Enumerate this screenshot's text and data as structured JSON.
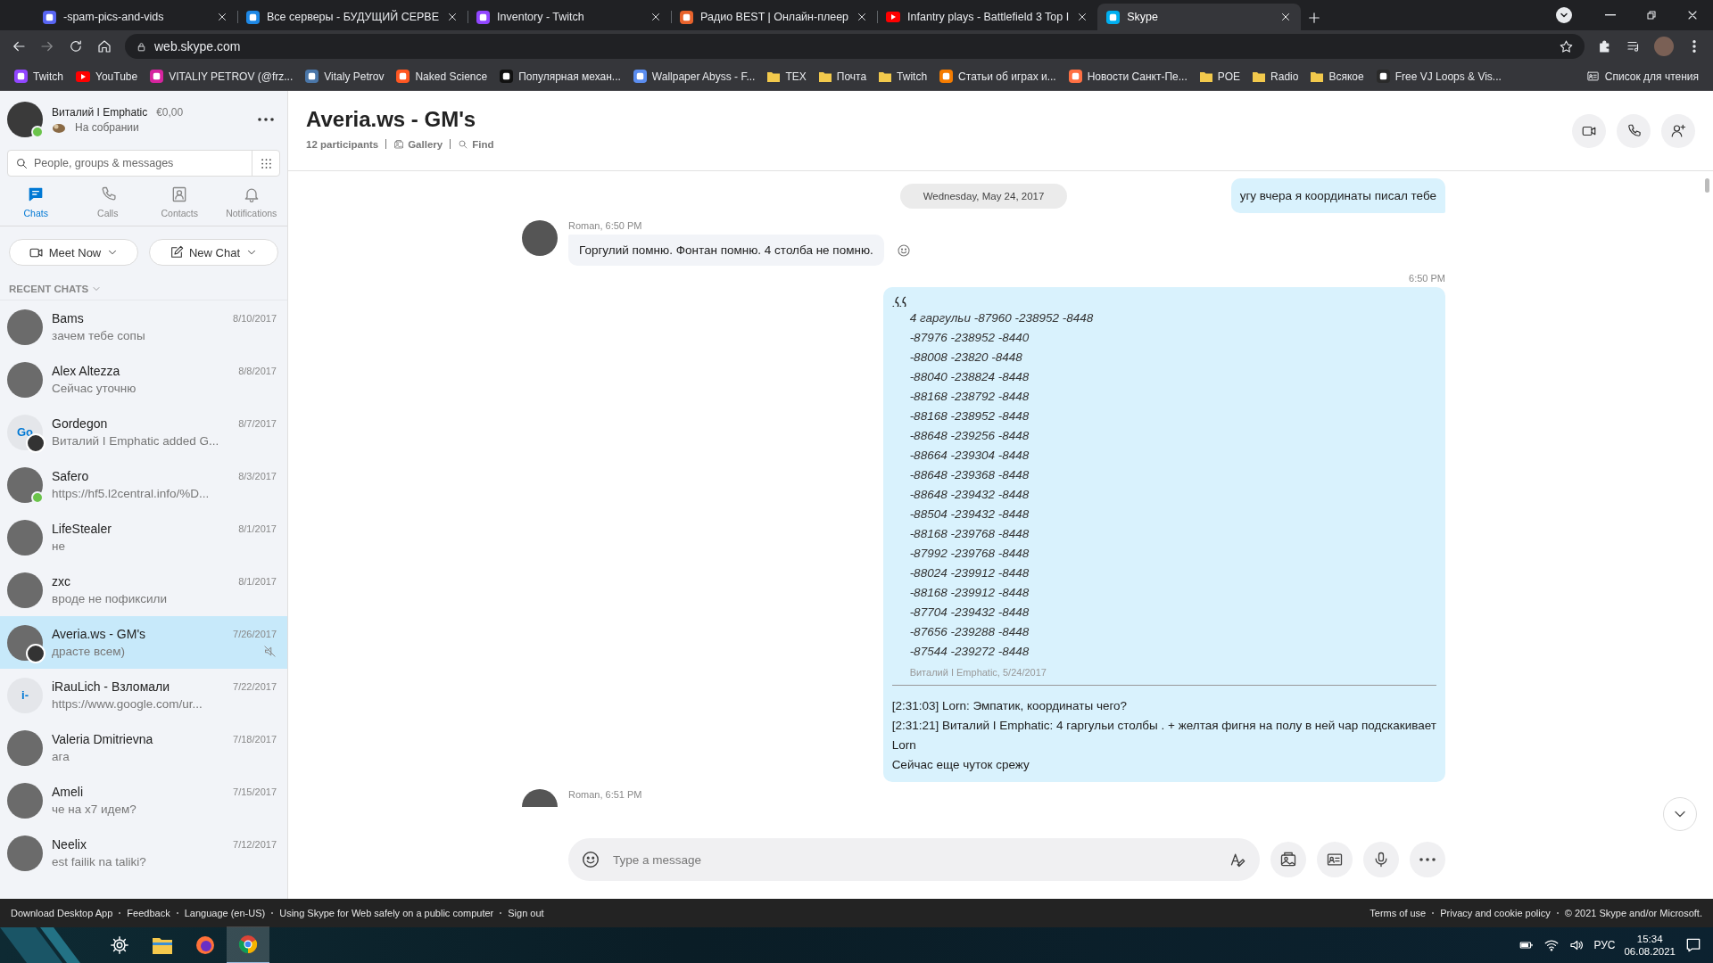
{
  "browser": {
    "tabs": [
      {
        "title": "-spam-pics-and-vids",
        "icon": {
          "kind": "site",
          "color": "#5865f2"
        },
        "selected": false
      },
      {
        "title": "Все серверы - БУДУЩИЙ СЕРВЕ",
        "icon": {
          "kind": "site",
          "color": "#1e88e5"
        },
        "selected": false
      },
      {
        "title": "Inventory - Twitch",
        "icon": {
          "kind": "site",
          "color": "#9146ff"
        },
        "selected": false
      },
      {
        "title": "Радио BEST | Онлайн-плеер",
        "icon": {
          "kind": "site",
          "color": "#e8632c"
        },
        "selected": false
      },
      {
        "title": "Infantry plays - Battlefield 3 Top I",
        "icon": {
          "kind": "play",
          "color": "#ff0000"
        },
        "selected": false
      },
      {
        "title": "Skype",
        "icon": {
          "kind": "site",
          "color": "#00aff0"
        },
        "selected": true
      }
    ],
    "url": "web.skype.com",
    "bookmarks": [
      {
        "label": "Twitch",
        "icon": {
          "kind": "site",
          "color": "#9146ff"
        }
      },
      {
        "label": "YouTube",
        "icon": {
          "kind": "play",
          "color": "#ff0000"
        }
      },
      {
        "label": "VITALIY PETROV (@frz...",
        "icon": {
          "kind": "site",
          "color": "#d6249f"
        }
      },
      {
        "label": "Vitaly Petrov",
        "icon": {
          "kind": "site",
          "color": "#4a76a8"
        }
      },
      {
        "label": "Naked Science",
        "icon": {
          "kind": "site",
          "color": "#ff5722"
        }
      },
      {
        "label": "Популярная механ...",
        "icon": {
          "kind": "site",
          "color": "#111111"
        }
      },
      {
        "label": "Wallpaper Abyss - F...",
        "icon": {
          "kind": "site",
          "color": "#5b8def"
        }
      },
      {
        "label": "TEX",
        "icon": {
          "kind": "folder",
          "color": "#f2c94c"
        }
      },
      {
        "label": "Почта",
        "icon": {
          "kind": "folder",
          "color": "#f2c94c"
        }
      },
      {
        "label": "Twitch",
        "icon": {
          "kind": "folder",
          "color": "#f2c94c"
        }
      },
      {
        "label": "Статьи об играх и...",
        "icon": {
          "kind": "site",
          "color": "#f57c00"
        }
      },
      {
        "label": "Новости Санкт-Пе...",
        "icon": {
          "kind": "site",
          "color": "#ff7043"
        }
      },
      {
        "label": "POE",
        "icon": {
          "kind": "folder",
          "color": "#f2c94c"
        }
      },
      {
        "label": "Radio",
        "icon": {
          "kind": "folder",
          "color": "#f2c94c"
        }
      },
      {
        "label": "Всякое",
        "icon": {
          "kind": "folder",
          "color": "#f2c94c"
        }
      },
      {
        "label": "Free VJ Loops & Vis...",
        "icon": {
          "kind": "site",
          "color": "#2a2a2a"
        }
      }
    ],
    "reading_list": "Список для чтения"
  },
  "sidebar": {
    "profile": {
      "name": "Виталий I Emphatic",
      "balance": "€0,00",
      "status": "На собрании",
      "online": true
    },
    "search": {
      "placeholder": "People, groups & messages"
    },
    "nav": [
      {
        "label": "Chats",
        "kind": "chats",
        "selected": true
      },
      {
        "label": "Calls",
        "kind": "calls",
        "selected": false
      },
      {
        "label": "Contacts",
        "kind": "contacts",
        "selected": false
      },
      {
        "label": "Notifications",
        "kind": "notifications",
        "selected": false
      }
    ],
    "buttons": [
      {
        "label": "Meet Now",
        "kind": "meet"
      },
      {
        "label": "New Chat",
        "kind": "new"
      }
    ],
    "recent_label": "RECENT CHATS",
    "chats": [
      {
        "name": "Bams",
        "date": "8/10/2017",
        "preview": "зачем тебе сопы",
        "avatar": {
          "kind": "photo"
        },
        "online": false,
        "group": false,
        "muted": false,
        "selected": false
      },
      {
        "name": "Alex Altezza",
        "date": "8/8/2017",
        "preview": "Сейчас уточню",
        "avatar": {
          "kind": "photo"
        },
        "online": false,
        "group": false,
        "muted": false,
        "selected": false
      },
      {
        "name": "Gordegon",
        "date": "8/7/2017",
        "preview": "Виталий I Emphatic added G...",
        "avatar": {
          "kind": "initials",
          "initials": "Go"
        },
        "online": false,
        "group": true,
        "muted": false,
        "selected": false
      },
      {
        "name": "Safero",
        "date": "8/3/2017",
        "preview": "https://hf5.l2central.info/%D...",
        "avatar": {
          "kind": "photo"
        },
        "online": true,
        "group": false,
        "muted": false,
        "selected": false
      },
      {
        "name": "LifeStealer",
        "date": "8/1/2017",
        "preview": "не",
        "avatar": {
          "kind": "photo"
        },
        "online": false,
        "group": false,
        "muted": false,
        "selected": false
      },
      {
        "name": "zxc",
        "date": "8/1/2017",
        "preview": "вроде не пофиксили",
        "avatar": {
          "kind": "photo"
        },
        "online": false,
        "group": false,
        "muted": false,
        "selected": false
      },
      {
        "name": "Averia.ws - GM's",
        "date": "7/26/2017",
        "preview": "драсте всем)",
        "avatar": {
          "kind": "photo"
        },
        "online": false,
        "group": true,
        "muted": true,
        "selected": true
      },
      {
        "name": "iRauLich - Взломали",
        "date": "7/22/2017",
        "preview": "https://www.google.com/ur...",
        "avatar": {
          "kind": "initials",
          "initials": "i-"
        },
        "online": false,
        "group": false,
        "muted": false,
        "selected": false
      },
      {
        "name": "Valeria Dmitrievna",
        "date": "7/18/2017",
        "preview": "ага",
        "avatar": {
          "kind": "photo"
        },
        "online": false,
        "group": false,
        "muted": false,
        "selected": false
      },
      {
        "name": "Ameli",
        "date": "7/15/2017",
        "preview": "че на х7 идем?",
        "avatar": {
          "kind": "photo"
        },
        "online": false,
        "group": false,
        "muted": false,
        "selected": false
      },
      {
        "name": "Neelix",
        "date": "7/12/2017",
        "preview": "est failik na taliki?",
        "avatar": {
          "kind": "photo"
        },
        "online": false,
        "group": false,
        "muted": false,
        "selected": false
      }
    ]
  },
  "chat": {
    "title": "Averia.ws - GM's",
    "participants": "12 participants",
    "gallery": "Gallery",
    "find": "Find",
    "top_row": {
      "date": "Wednesday, May 24, 2017",
      "message": "угу вчера я координаты писал тебе"
    },
    "messages": [
      {
        "kind": "incoming",
        "author": "Roman, 6:50 PM",
        "text": "Горгулий помню. Фонтан помню. 4 столба не помню."
      },
      {
        "kind": "quote",
        "time": "6:50 PM",
        "quote_lines": [
          "4 гаргульи -87960 -238952 -8448",
          "-87976 -238952 -8440",
          "-88008 -23820 -8448",
          "-88040 -238824 -8448",
          "-88168 -238792 -8448",
          "-88168 -238952 -8448",
          "-88648 -239256 -8448",
          "-88664 -239304 -8448",
          "-88648 -239368 -8448",
          "-88648 -239432 -8448",
          "-88504 -239432 -8448",
          "-88168 -239768 -8448",
          "-87992 -239768 -8448",
          "-88024 -239912 -8448",
          "-88168 -239912 -8448",
          "-87704 -239432 -8448",
          "-87656 -239288 -8448",
          "-87544 -239272 -8448"
        ],
        "quote_source": "Виталий I Emphatic, 5/24/2017",
        "lines": [
          "[2:31:03] Lorn: Эмпатик, координаты чего?",
          "[2:31:21] Виталий I Emphatic: 4 гаргульи столбы . + желтая фигня на полу в ней чар подскакивает",
          "Lorn",
          "Сейчас еще чуток срежу"
        ]
      },
      {
        "kind": "incoming",
        "author": "Roman, 6:51 PM"
      }
    ],
    "compose": {
      "placeholder": "Type a message"
    }
  },
  "footer": {
    "left": [
      "Download Desktop App",
      "Feedback",
      "Language (en-US)",
      "Using Skype for Web safely on a public computer",
      "Sign out"
    ],
    "right": [
      "Terms of use",
      "Privacy and cookie policy",
      "© 2021 Skype and/or Microsoft."
    ]
  },
  "taskbar": {
    "apps": [
      {
        "kind": "settings",
        "selected": false
      },
      {
        "kind": "explorer",
        "selected": false
      },
      {
        "kind": "firefox",
        "selected": false
      },
      {
        "kind": "chrome",
        "selected": true
      }
    ],
    "language": "РУС",
    "time": "15:34",
    "date": "06.08.2021"
  }
}
